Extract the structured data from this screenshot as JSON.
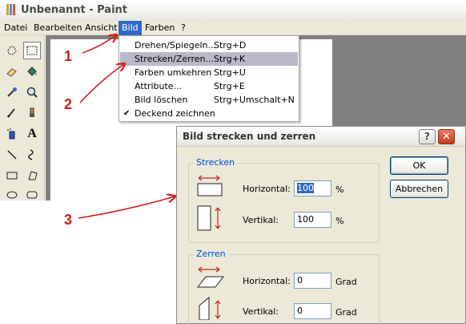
{
  "window": {
    "title": "Unbenannt - Paint",
    "menu": [
      "Datei",
      "Bearbeiten",
      "Ansicht",
      "Bild",
      "Farben",
      "?"
    ],
    "active_menu_index": 3
  },
  "dropdown": {
    "items": [
      {
        "label": "Drehen/Spiegeln...",
        "shortcut": "Strg+D"
      },
      {
        "label": "Strecken/Zerren...",
        "shortcut": "Strg+K",
        "highlighted": true
      },
      {
        "label": "Farben umkehren",
        "shortcut": "Strg+U"
      },
      {
        "label": "Attribute...",
        "shortcut": "Strg+E"
      },
      {
        "label": "Bild löschen",
        "shortcut": "Strg+Umschalt+N"
      },
      {
        "label": "Deckend zeichnen",
        "shortcut": "",
        "checked": true
      }
    ]
  },
  "annotations": {
    "step1": "1",
    "step2": "2",
    "step3": "3",
    "color": "#d41e1e"
  },
  "dialog": {
    "title": "Bild strecken und zerren",
    "help_label": "?",
    "close_label": "✕",
    "strecken": {
      "title": "Strecken",
      "horizontal_label": "Horizontal:",
      "horizontal_value": "100",
      "horizontal_unit": "%",
      "vertical_label": "Vertikal:",
      "vertical_value": "100",
      "vertical_unit": "%"
    },
    "zerren": {
      "title": "Zerren",
      "horizontal_label": "Horizontal:",
      "horizontal_value": "0",
      "horizontal_unit": "Grad",
      "vertical_label": "Vertikal:",
      "vertical_value": "0",
      "vertical_unit": "Grad"
    },
    "ok_label": "OK",
    "cancel_label": "Abbrechen"
  },
  "tools": [
    "free-select",
    "rect-select",
    "eraser",
    "fill",
    "color-picker",
    "magnifier",
    "pencil",
    "brush",
    "airbrush",
    "text",
    "line",
    "curve",
    "rectangle",
    "polygon",
    "ellipse",
    "rounded-rectangle"
  ]
}
